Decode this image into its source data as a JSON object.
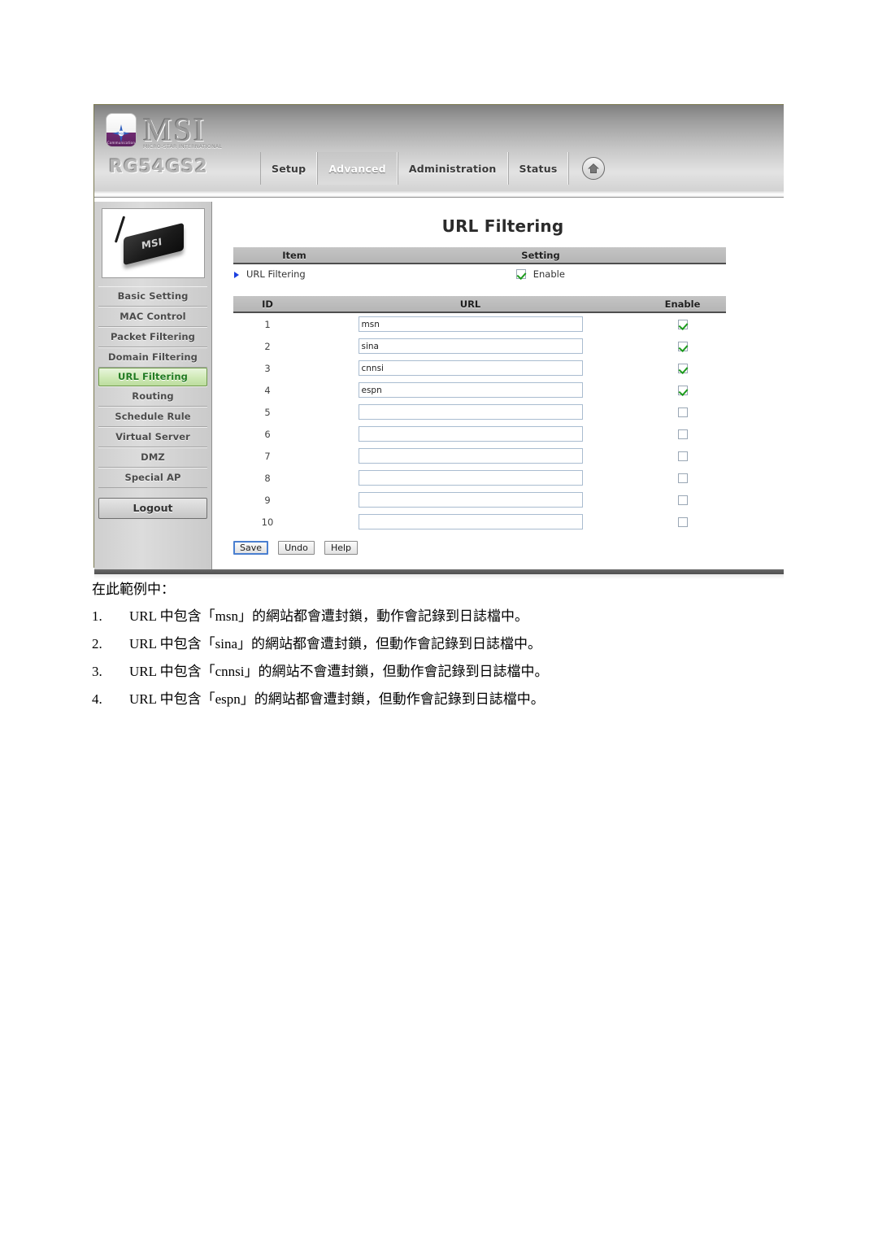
{
  "document": {
    "lead": "在此範例中：",
    "items": [
      {
        "num": "1.",
        "text": "URL 中包含「msn」的網站都會遭封鎖，動作會記錄到日誌檔中。"
      },
      {
        "num": "2.",
        "text": "URL 中包含「sina」的網站都會遭封鎖，但動作會記錄到日誌檔中。"
      },
      {
        "num": "3.",
        "text": "URL 中包含「cnnsi」的網站不會遭封鎖，但動作會記錄到日誌檔中。"
      },
      {
        "num": "4.",
        "text": "URL 中包含「espn」的網站都會遭封鎖，但動作會記錄到日誌檔中。"
      }
    ]
  },
  "router_ui": {
    "brand": {
      "logo_text": "MSI",
      "logo_subtitle": "MICRO-STAR INTERNATIONAL",
      "badge_text": "Communication",
      "badge_mark": "MSI",
      "model": "RG54GS2",
      "device_label": "MSI"
    },
    "nav": {
      "tabs": [
        {
          "label": "Setup",
          "active": false
        },
        {
          "label": "Advanced",
          "active": true
        },
        {
          "label": "Administration",
          "active": false
        },
        {
          "label": "Status",
          "active": false
        }
      ],
      "home_icon": "home-icon"
    },
    "sidebar": {
      "items": [
        {
          "label": "Basic Setting",
          "selected": false
        },
        {
          "label": "MAC Control",
          "selected": false
        },
        {
          "label": "Packet Filtering",
          "selected": false
        },
        {
          "label": "Domain Filtering",
          "selected": false
        },
        {
          "label": "URL Filtering",
          "selected": true
        },
        {
          "label": "Routing",
          "selected": false
        },
        {
          "label": "Schedule Rule",
          "selected": false
        },
        {
          "label": "Virtual Server",
          "selected": false
        },
        {
          "label": "DMZ",
          "selected": false
        },
        {
          "label": "Special AP",
          "selected": false
        }
      ],
      "logout_label": "Logout"
    },
    "page_title": "URL Filtering",
    "setting_table": {
      "headers": {
        "item": "Item",
        "setting": "Setting"
      },
      "row_label": "URL Filtering",
      "enable_label": "Enable",
      "enabled": true
    },
    "url_table": {
      "headers": {
        "id": "ID",
        "url": "URL",
        "enable": "Enable"
      },
      "rows": [
        {
          "id": "1",
          "url": "msn",
          "enabled": true
        },
        {
          "id": "2",
          "url": "sina",
          "enabled": true
        },
        {
          "id": "3",
          "url": "cnnsi",
          "enabled": true
        },
        {
          "id": "4",
          "url": "espn",
          "enabled": true
        },
        {
          "id": "5",
          "url": "",
          "enabled": false
        },
        {
          "id": "6",
          "url": "",
          "enabled": false
        },
        {
          "id": "7",
          "url": "",
          "enabled": false
        },
        {
          "id": "8",
          "url": "",
          "enabled": false
        },
        {
          "id": "9",
          "url": "",
          "enabled": false
        },
        {
          "id": "10",
          "url": "",
          "enabled": false
        }
      ]
    },
    "buttons": {
      "save": "Save",
      "undo": "Undo",
      "help": "Help"
    },
    "colors": {
      "selected_menu_text": "#1f7a1f",
      "arrow_blue": "#1b3fe0",
      "check_green": "#1d9c1d",
      "focus_blue": "#4a7fd0"
    }
  }
}
